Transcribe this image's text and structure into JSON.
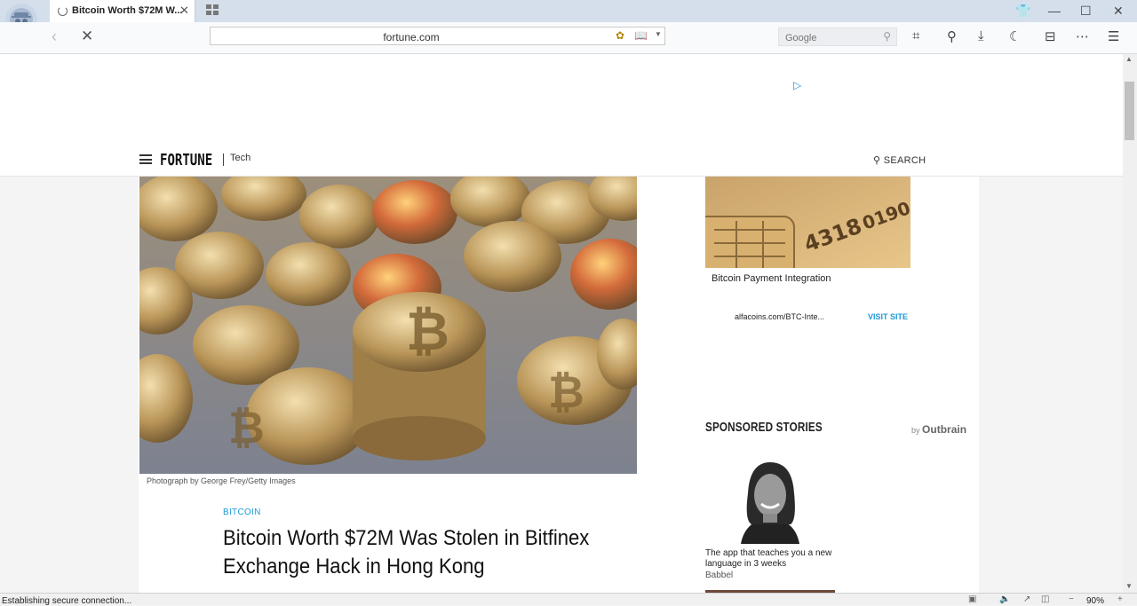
{
  "browser": {
    "tab_title": "Bitcoin Worth $72M W...",
    "url": "fortune.com",
    "search_placeholder": "Google",
    "status_text": "Establishing secure connection...",
    "zoom": "90%"
  },
  "site": {
    "logo": "FORTUNE",
    "section": "Tech",
    "search_label": "SEARCH"
  },
  "article": {
    "photo_credit": "Photograph by George Frey/Getty Images",
    "category": "BITCOIN",
    "headline": "Bitcoin Worth $72M Was Stolen in Bitfinex Exchange Hack in Hong Kong"
  },
  "sidebar": {
    "ad": {
      "title": "Bitcoin Payment Integration",
      "url": "alfacoins.com/BTC-Inte...",
      "cta": "VISIT SITE"
    },
    "sponsored": {
      "heading": "SPONSORED STORIES",
      "by": "by",
      "brand": "Outbrain",
      "stories": [
        {
          "title": "The app that teaches you a new language in 3 weeks",
          "source": "Babbel"
        }
      ]
    }
  },
  "colors": {
    "accent": "#1c9ad6",
    "tabbar": "#d5dfec"
  }
}
